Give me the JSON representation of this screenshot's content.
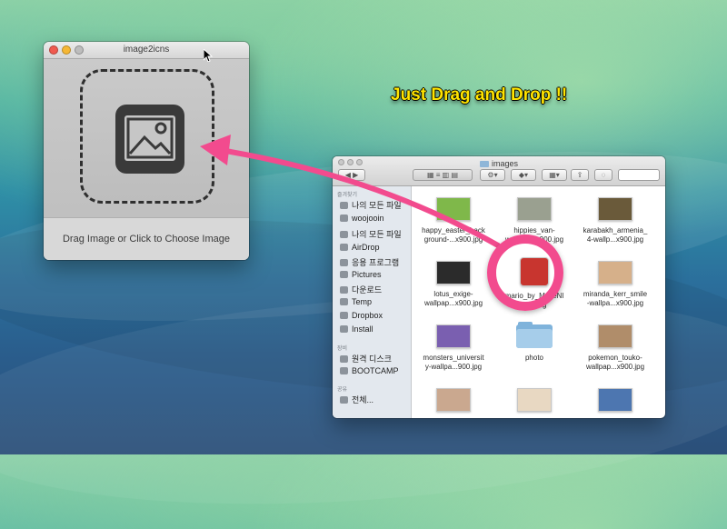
{
  "app_window": {
    "title": "image2icns",
    "footer_text": "Drag Image or Click to Choose Image"
  },
  "headline": "Just Drag and Drop !!",
  "finder": {
    "title": "images",
    "sidebar": {
      "favorites_label": "즐겨찾기",
      "devices_label": "장비",
      "shared_label": "공유",
      "items_favorites": [
        {
          "label": "나의 모든 파일",
          "icon": "all-files-icon"
        },
        {
          "label": "woojooin",
          "icon": "home-icon"
        },
        {
          "label": "나의 모든 파일",
          "icon": "all-my-files-icon"
        },
        {
          "label": "AirDrop",
          "icon": "airdrop-icon"
        },
        {
          "label": "응용 프로그램",
          "icon": "applications-icon"
        },
        {
          "label": "Pictures",
          "icon": "pictures-icon"
        },
        {
          "label": "다운로드",
          "icon": "downloads-icon"
        },
        {
          "label": "Temp",
          "icon": "folder-icon"
        },
        {
          "label": "Dropbox",
          "icon": "dropbox-icon"
        },
        {
          "label": "Install",
          "icon": "folder-icon"
        }
      ],
      "items_devices": [
        {
          "label": "원격 디스크",
          "icon": "remote-disc-icon"
        },
        {
          "label": "BOOTCAMP",
          "icon": "disk-icon"
        }
      ],
      "items_shared": [
        {
          "label": "전체...",
          "icon": "network-icon"
        }
      ]
    },
    "files": [
      {
        "line1": "happy_easter_back",
        "line2": "ground-...x900.jpg",
        "thumb_color": "#7fb84a"
      },
      {
        "line1": "hippies_van-",
        "line2": "wallpap...x900.jpg",
        "thumb_color": "#9aa090"
      },
      {
        "line1": "karabakh_armenia_",
        "line2": "4-wallp...x900.jpg",
        "thumb_color": "#6a5a3a"
      },
      {
        "line1": "lotus_exige-",
        "line2": "wallpap...x900.jpg",
        "thumb_color": "#2b2b2b"
      },
      {
        "line1": "mario_by_MazeNl",
        "line2": "...7.png",
        "thumb_color": "#c8352f"
      },
      {
        "line1": "miranda_kerr_smile",
        "line2": "-wallpa...x900.jpg",
        "thumb_color": "#d6b08a"
      },
      {
        "line1": "monsters_universit",
        "line2": "y-wallpa...900.jpg",
        "thumb_color": "#7a5fb0"
      },
      {
        "line1": "photo",
        "line2": "",
        "thumb_color": "folder"
      },
      {
        "line1": "pokemon_touko-",
        "line2": "wallpap...x900.jpg",
        "thumb_color": "#b08d6a"
      },
      {
        "line1": "",
        "line2": "",
        "thumb_color": "#caa88f"
      },
      {
        "line1": "",
        "line2": "",
        "thumb_color": "#e8d8c2"
      },
      {
        "line1": "",
        "line2": "",
        "thumb_color": "#4d76b0"
      }
    ]
  },
  "colors": {
    "headline": "#ffe400",
    "arrow": "#f24b8e",
    "ring": "#f24b8e"
  }
}
